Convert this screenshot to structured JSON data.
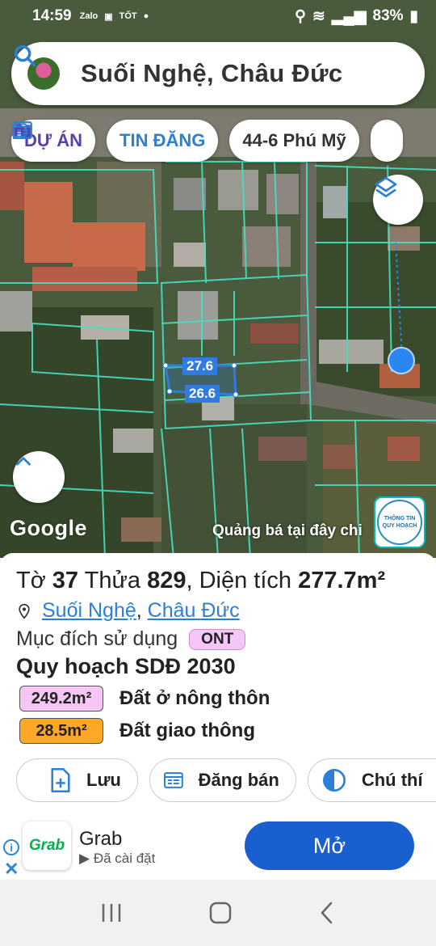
{
  "status_bar": {
    "time": "14:59",
    "app_icons": [
      "Zalo",
      "image",
      "TỐT"
    ],
    "battery": "83%"
  },
  "search": {
    "title": "Suối Nghệ, Châu Đức"
  },
  "chips": [
    {
      "label": "DỰ ÁN",
      "icon": "building-icon"
    },
    {
      "label": "TIN ĐĂNG",
      "icon": "listing-icon"
    },
    {
      "label": "44-6 Phú Mỹ",
      "icon": ""
    }
  ],
  "map": {
    "dimensions": [
      "27.6",
      "26.6"
    ],
    "google_label": "Google",
    "promo": "Quảng bá tại đây chi",
    "info_button": [
      "THÔNG TIN",
      "QUY HOẠCH"
    ]
  },
  "parcel": {
    "sheet_label": "Tờ",
    "sheet_no": "37",
    "plot_label": "Thửa",
    "plot_no": "829",
    "area_label": "Diện tích",
    "area": "277.7m²",
    "ward": "Suối Nghệ",
    "district": "Châu Đức",
    "purpose_label": "Mục đích sử dụng",
    "purpose_code": "ONT",
    "plan_title": "Quy hoạch SDĐ 2030",
    "zones": [
      {
        "area": "249.2m²",
        "label": "Đất ở nông thôn",
        "color": "#f6c6f6"
      },
      {
        "area": "28.5m²",
        "label": "Đất giao thông",
        "color": "#ffa726"
      }
    ],
    "actions": [
      {
        "label": "Lưu"
      },
      {
        "label": "Đăng bán"
      },
      {
        "label": "Chú thí"
      }
    ]
  },
  "ad": {
    "brand": "Grab",
    "title": "Grab",
    "subtitle": "Đã cài đặt",
    "button": "Mở"
  }
}
